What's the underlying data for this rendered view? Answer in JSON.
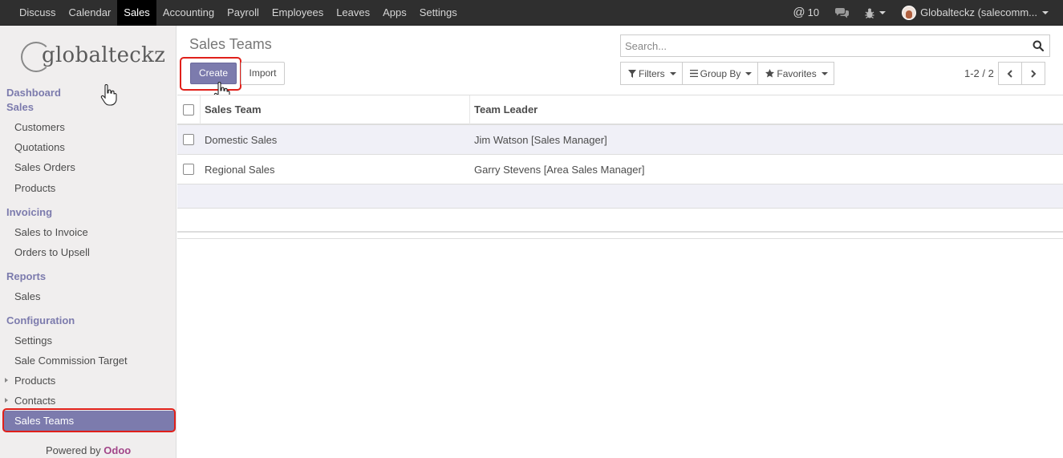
{
  "topbar": {
    "menu": [
      "Discuss",
      "Calendar",
      "Sales",
      "Accounting",
      "Payroll",
      "Employees",
      "Leaves",
      "Apps",
      "Settings"
    ],
    "active_menu": "Sales",
    "notifications_count": "10",
    "user_label": "Globalteckz (salecomm..."
  },
  "sidebar": {
    "logo_text": "globalteckz",
    "sections": {
      "dashboard": "Dashboard",
      "sales": "Sales",
      "invoicing": "Invoicing",
      "reports": "Reports",
      "configuration": "Configuration"
    },
    "items": {
      "customers": "Customers",
      "quotations": "Quotations",
      "sales_orders": "Sales Orders",
      "products": "Products",
      "sales_to_invoice": "Sales to Invoice",
      "orders_to_upsell": "Orders to Upsell",
      "reports_sales": "Sales",
      "settings": "Settings",
      "sale_commission_target": "Sale Commission Target",
      "config_products": "Products",
      "contacts": "Contacts",
      "sales_teams": "Sales Teams"
    },
    "powered_by": "Powered by",
    "powered_brand": "Odoo"
  },
  "control_panel": {
    "title": "Sales Teams",
    "create_label": "Create",
    "import_label": "Import",
    "search_placeholder": "Search...",
    "filters_label": "Filters",
    "group_by_label": "Group By",
    "favorites_label": "Favorites",
    "pager": "1-2 / 2"
  },
  "table": {
    "columns": [
      "Sales Team",
      "Team Leader"
    ],
    "rows": [
      {
        "team": "Domestic Sales",
        "leader": "Jim Watson [Sales Manager]"
      },
      {
        "team": "Regional Sales",
        "leader": "Garry Stevens [Area Sales Manager]"
      }
    ]
  },
  "colors": {
    "accent": "#7c7bad",
    "highlight": "#e0201a",
    "topbar": "#2f2f2f"
  }
}
